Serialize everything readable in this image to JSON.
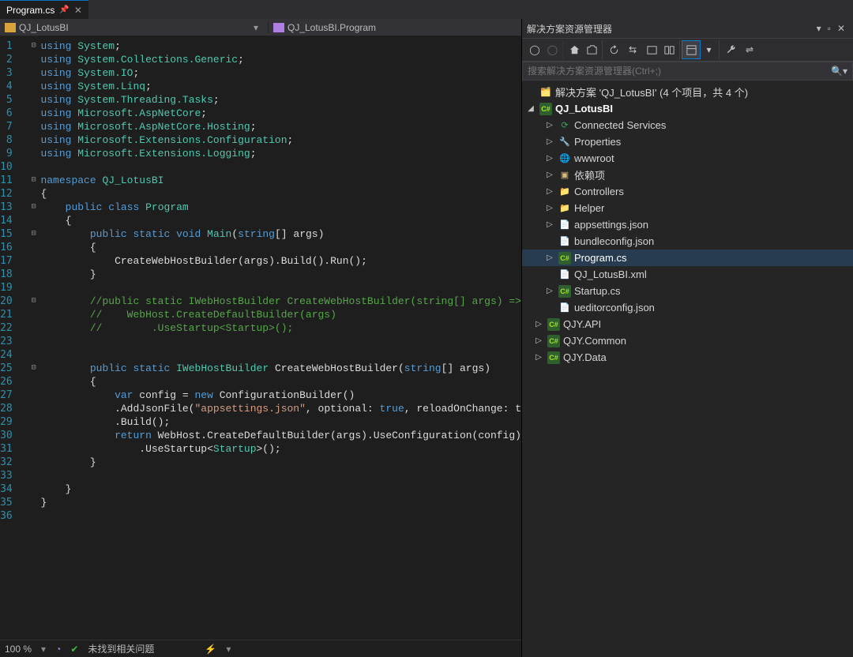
{
  "tab": {
    "filename": "Program.cs"
  },
  "breadcrumb": {
    "project": "QJ_LotusBI",
    "class": "QJ_LotusBI.Program"
  },
  "code": {
    "lines": [
      {
        "n": 1,
        "indent": 0,
        "fold": "-",
        "tokens": [
          [
            "kw",
            "using"
          ],
          [
            "punct",
            " "
          ],
          [
            "type",
            "System"
          ],
          [
            "punct",
            ";"
          ]
        ]
      },
      {
        "n": 2,
        "indent": 0,
        "tokens": [
          [
            "kw",
            "using"
          ],
          [
            "punct",
            " "
          ],
          [
            "type",
            "System.Collections.Generic"
          ],
          [
            "punct",
            ";"
          ]
        ]
      },
      {
        "n": 3,
        "indent": 0,
        "tokens": [
          [
            "kw",
            "using"
          ],
          [
            "punct",
            " "
          ],
          [
            "type",
            "System.IO"
          ],
          [
            "punct",
            ";"
          ]
        ]
      },
      {
        "n": 4,
        "indent": 0,
        "tokens": [
          [
            "kw",
            "using"
          ],
          [
            "punct",
            " "
          ],
          [
            "type",
            "System.Linq"
          ],
          [
            "punct",
            ";"
          ]
        ]
      },
      {
        "n": 5,
        "indent": 0,
        "tokens": [
          [
            "kw",
            "using"
          ],
          [
            "punct",
            " "
          ],
          [
            "type",
            "System.Threading.Tasks"
          ],
          [
            "punct",
            ";"
          ]
        ]
      },
      {
        "n": 6,
        "indent": 0,
        "tokens": [
          [
            "kw",
            "using"
          ],
          [
            "punct",
            " "
          ],
          [
            "type",
            "Microsoft.AspNetCore"
          ],
          [
            "punct",
            ";"
          ]
        ]
      },
      {
        "n": 7,
        "indent": 0,
        "tokens": [
          [
            "kw",
            "using"
          ],
          [
            "punct",
            " "
          ],
          [
            "type",
            "Microsoft.AspNetCore.Hosting"
          ],
          [
            "punct",
            ";"
          ]
        ]
      },
      {
        "n": 8,
        "indent": 0,
        "tokens": [
          [
            "kw",
            "using"
          ],
          [
            "punct",
            " "
          ],
          [
            "type",
            "Microsoft.Extensions.Configuration"
          ],
          [
            "punct",
            ";"
          ]
        ]
      },
      {
        "n": 9,
        "indent": 0,
        "tokens": [
          [
            "kw",
            "using"
          ],
          [
            "punct",
            " "
          ],
          [
            "type",
            "Microsoft.Extensions.Logging"
          ],
          [
            "punct",
            ";"
          ]
        ]
      },
      {
        "n": 10,
        "indent": 0,
        "tokens": []
      },
      {
        "n": 11,
        "indent": 0,
        "fold": "-",
        "tokens": [
          [
            "kw",
            "namespace"
          ],
          [
            "punct",
            " "
          ],
          [
            "type",
            "QJ_LotusBI"
          ]
        ]
      },
      {
        "n": 12,
        "indent": 0,
        "tokens": [
          [
            "punct",
            "{"
          ]
        ]
      },
      {
        "n": 13,
        "indent": 1,
        "fold": "-",
        "tokens": [
          [
            "kw",
            "public"
          ],
          [
            "punct",
            " "
          ],
          [
            "kw",
            "class"
          ],
          [
            "punct",
            " "
          ],
          [
            "type",
            "Program"
          ]
        ]
      },
      {
        "n": 14,
        "indent": 1,
        "tokens": [
          [
            "punct",
            "{"
          ]
        ]
      },
      {
        "n": 15,
        "indent": 2,
        "fold": "-",
        "tokens": [
          [
            "kw",
            "public"
          ],
          [
            "punct",
            " "
          ],
          [
            "kw",
            "static"
          ],
          [
            "punct",
            " "
          ],
          [
            "kw",
            "void"
          ],
          [
            "punct",
            " "
          ],
          [
            "type",
            "Main"
          ],
          [
            "punct",
            "("
          ],
          [
            "kw",
            "string"
          ],
          [
            "punct",
            "[] args)"
          ]
        ]
      },
      {
        "n": 16,
        "indent": 2,
        "tokens": [
          [
            "punct",
            "{"
          ]
        ]
      },
      {
        "n": 17,
        "indent": 3,
        "tokens": [
          [
            "punct",
            "CreateWebHostBuilder(args).Build().Run();"
          ]
        ]
      },
      {
        "n": 18,
        "indent": 2,
        "tokens": [
          [
            "punct",
            "}"
          ]
        ]
      },
      {
        "n": 19,
        "indent": 0,
        "tokens": []
      },
      {
        "n": 20,
        "indent": 2,
        "fold": "-",
        "tokens": [
          [
            "comment",
            "//public static IWebHostBuilder CreateWebHostBuilder(string[] args) =>"
          ]
        ]
      },
      {
        "n": 21,
        "indent": 2,
        "tokens": [
          [
            "comment",
            "//    WebHost.CreateDefaultBuilder(args)"
          ]
        ]
      },
      {
        "n": 22,
        "indent": 2,
        "tokens": [
          [
            "comment",
            "//        .UseStartup<Startup>();"
          ]
        ]
      },
      {
        "n": 23,
        "indent": 0,
        "tokens": []
      },
      {
        "n": 24,
        "indent": 0,
        "tokens": []
      },
      {
        "n": 25,
        "indent": 2,
        "fold": "-",
        "tokens": [
          [
            "kw",
            "public"
          ],
          [
            "punct",
            " "
          ],
          [
            "kw",
            "static"
          ],
          [
            "punct",
            " "
          ],
          [
            "type",
            "IWebHostBuilder"
          ],
          [
            "punct",
            " CreateWebHostBuilder("
          ],
          [
            "kw",
            "string"
          ],
          [
            "punct",
            "[] args)"
          ]
        ]
      },
      {
        "n": 26,
        "indent": 2,
        "tokens": [
          [
            "punct",
            "{"
          ]
        ]
      },
      {
        "n": 27,
        "indent": 3,
        "tokens": [
          [
            "kw",
            "var"
          ],
          [
            "punct",
            " config = "
          ],
          [
            "kw",
            "new"
          ],
          [
            "punct",
            " ConfigurationBuilder()"
          ]
        ]
      },
      {
        "n": 28,
        "indent": 3,
        "tokens": [
          [
            "punct",
            ".AddJsonFile("
          ],
          [
            "str",
            "\"appsettings.json\""
          ],
          [
            "punct",
            ", optional: "
          ],
          [
            "kw",
            "true"
          ],
          [
            "punct",
            ", reloadOnChange: t"
          ]
        ]
      },
      {
        "n": 29,
        "indent": 3,
        "tokens": [
          [
            "punct",
            ".Build();"
          ]
        ]
      },
      {
        "n": 30,
        "indent": 3,
        "tokens": [
          [
            "kw",
            "return"
          ],
          [
            "punct",
            " WebHost.CreateDefaultBuilder(args).UseConfiguration(config)"
          ]
        ]
      },
      {
        "n": 31,
        "indent": 4,
        "tokens": [
          [
            "punct",
            ".UseStartup<"
          ],
          [
            "type",
            "Startup"
          ],
          [
            "punct",
            ">();"
          ]
        ]
      },
      {
        "n": 32,
        "indent": 2,
        "tokens": [
          [
            "punct",
            "}"
          ]
        ]
      },
      {
        "n": 33,
        "indent": 0,
        "tokens": []
      },
      {
        "n": 34,
        "indent": 1,
        "tokens": [
          [
            "punct",
            "}"
          ]
        ]
      },
      {
        "n": 35,
        "indent": 0,
        "tokens": [
          [
            "punct",
            "}"
          ]
        ]
      },
      {
        "n": 36,
        "indent": 0,
        "tokens": []
      }
    ]
  },
  "status": {
    "zoom": "100 %",
    "issues": "未找到相关问题"
  },
  "solution_panel": {
    "title": "解决方案资源管理器",
    "search_placeholder": "搜索解决方案资源管理器(Ctrl+;)",
    "root": "解决方案 'QJ_LotusBI' (4 个项目，共 4 个)",
    "project": "QJ_LotusBI",
    "items": [
      {
        "kind": "svc",
        "label": "Connected Services"
      },
      {
        "kind": "prop",
        "label": "Properties"
      },
      {
        "kind": "globe",
        "label": "wwwroot"
      },
      {
        "kind": "dep",
        "label": "依赖项"
      },
      {
        "kind": "folder",
        "label": "Controllers"
      },
      {
        "kind": "folder",
        "label": "Helper"
      },
      {
        "kind": "json",
        "label": "appsettings.json",
        "expand": true
      },
      {
        "kind": "json",
        "label": "bundleconfig.json"
      },
      {
        "kind": "cs",
        "label": "Program.cs",
        "sel": true,
        "expand": true
      },
      {
        "kind": "xml",
        "label": "QJ_LotusBI.xml"
      },
      {
        "kind": "cs",
        "label": "Startup.cs",
        "expand": true
      },
      {
        "kind": "json",
        "label": "ueditorconfig.json"
      }
    ],
    "projects": [
      {
        "label": "QJY.API"
      },
      {
        "label": "QJY.Common"
      },
      {
        "label": "QJY.Data"
      }
    ]
  }
}
